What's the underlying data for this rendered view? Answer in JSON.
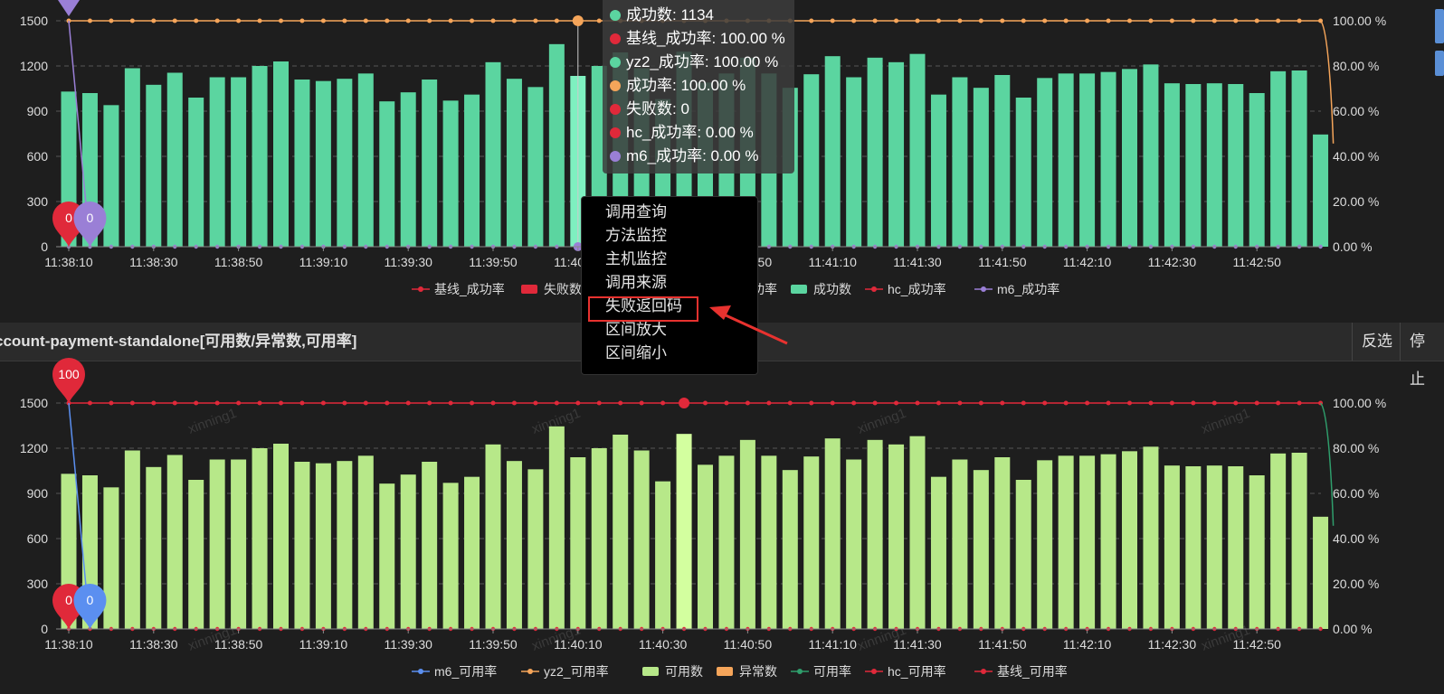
{
  "time_labels": [
    "11:38:10",
    "11:38:30",
    "11:38:50",
    "11:39:10",
    "11:39:30",
    "11:39:50",
    "11:40:10",
    "11:40:30",
    "11:40:50",
    "11:41:10",
    "11:41:30",
    "11:41:50",
    "11:42:10",
    "11:42:30",
    "11:42:50"
  ],
  "y_left_ticks": [
    "0",
    "300",
    "600",
    "900",
    "1200",
    "1500"
  ],
  "y_right_ticks": [
    "0.00 %",
    "20.00 %",
    "40.00 %",
    "60.00 %",
    "80.00 %",
    "100.00 %"
  ],
  "colors": {
    "bar_top": "#5bd5a0",
    "bar_top_highlight": "#7ef0c0",
    "bar_bottom": "#b7e889",
    "bar_bottom_highlight": "#d3ff9f",
    "orange": "#f5a55a",
    "red": "#e0293a",
    "purple": "#9a7fd6",
    "blue": "#5b8ff0",
    "green_line": "#2f9e6c",
    "accent_red": "#e8322f"
  },
  "top_chart": {
    "legend": [
      "基线_成功率",
      "失败数",
      "yz2_成功率",
      "成功率",
      "成功数",
      "hc_成功率",
      "m6_成功率"
    ],
    "pins": [
      {
        "label": "0",
        "color": "#e0293a"
      },
      {
        "label": "0",
        "color": "#9a7fd6"
      }
    ]
  },
  "tooltip": {
    "rows": [
      {
        "text": "成功数: 1134",
        "color": "#5bd5a0"
      },
      {
        "text": "基线_成功率: 100.00 %",
        "color": "#e0293a"
      },
      {
        "text": "yz2_成功率: 100.00 %",
        "color": "#5bd5a0"
      },
      {
        "text": "成功率: 100.00 %",
        "color": "#f5a55a"
      },
      {
        "text": "失败数: 0",
        "color": "#e0293a"
      },
      {
        "text": "hc_成功率: 0.00 %",
        "color": "#e0293a"
      },
      {
        "text": "m6_成功率: 0.00 %",
        "color": "#9a7fd6"
      }
    ]
  },
  "context_menu": {
    "items": [
      "调用查询",
      "方法监控",
      "主机监控",
      "调用来源",
      "失败返回码",
      "区间放大",
      "区间缩小"
    ]
  },
  "section2": {
    "title": "ccount-payment-standalone[可用数/异常数,可用率]",
    "btn_invert": "反选",
    "btn_stop": "停止"
  },
  "bottom_chart": {
    "legend": [
      "m6_可用率",
      "yz2_可用率",
      "可用数",
      "异常数",
      "可用率",
      "hc_可用率",
      "基线_可用率"
    ],
    "pins": [
      {
        "label": "100",
        "color": "#e0293a"
      },
      {
        "label": "0",
        "color": "#e0293a"
      },
      {
        "label": "0",
        "color": "#5b8ff0"
      }
    ],
    "watermark": "xinning1"
  },
  "chart_data": [
    {
      "type": "bar",
      "categories": [
        "11:38:10",
        "11:38:30",
        "11:38:50",
        "11:39:10",
        "11:39:30",
        "11:39:50",
        "11:40:10",
        "11:40:30",
        "11:40:50",
        "11:41:10",
        "11:41:30",
        "11:41:50",
        "11:42:10",
        "11:42:30",
        "11:42:50"
      ],
      "series": [
        {
          "name": "成功数",
          "values": [
            1030,
            1020,
            940,
            1185,
            1075,
            1155,
            990,
            1125,
            1125,
            1200,
            1230,
            1110,
            1100,
            1115,
            1150,
            965,
            1025,
            1110,
            970,
            1010,
            1225,
            1115,
            1060,
            1345,
            1134,
            1200,
            1290,
            1185,
            980,
            1295,
            1090,
            1150,
            1255,
            1150,
            1055,
            1145,
            1265,
            1125,
            1255,
            1225,
            1280,
            1010,
            1125,
            1055,
            1140,
            990,
            1120,
            1150,
            1150,
            1160,
            1180,
            1210,
            1085,
            1080,
            1085,
            1080,
            1020,
            1165,
            1170,
            745
          ]
        },
        {
          "name": "成功率",
          "values": "100.00 % at all points"
        },
        {
          "name": "失败数",
          "values": "0 at all points"
        }
      ],
      "ylim": [
        0,
        1500
      ],
      "y2lim": [
        0,
        100
      ]
    },
    {
      "type": "bar",
      "categories": [
        "11:38:10",
        "11:38:30",
        "11:38:50",
        "11:39:10",
        "11:39:30",
        "11:39:50",
        "11:40:10",
        "11:40:30",
        "11:40:50",
        "11:41:10",
        "11:41:30",
        "11:41:50",
        "11:42:10",
        "11:42:30",
        "11:42:50"
      ],
      "series": [
        {
          "name": "可用数",
          "values": [
            1030,
            1020,
            940,
            1185,
            1075,
            1155,
            990,
            1125,
            1125,
            1200,
            1230,
            1110,
            1100,
            1115,
            1150,
            965,
            1025,
            1110,
            970,
            1010,
            1225,
            1115,
            1060,
            1345,
            1140,
            1200,
            1290,
            1185,
            980,
            1295,
            1090,
            1150,
            1255,
            1150,
            1055,
            1145,
            1265,
            1125,
            1255,
            1225,
            1280,
            1010,
            1125,
            1055,
            1140,
            990,
            1120,
            1150,
            1150,
            1160,
            1180,
            1210,
            1085,
            1080,
            1085,
            1080,
            1020,
            1165,
            1170,
            745
          ]
        },
        {
          "name": "基线_可用率",
          "values": "100.00 % at all points"
        }
      ],
      "ylim": [
        0,
        1500
      ],
      "y2lim": [
        0,
        100
      ]
    }
  ]
}
